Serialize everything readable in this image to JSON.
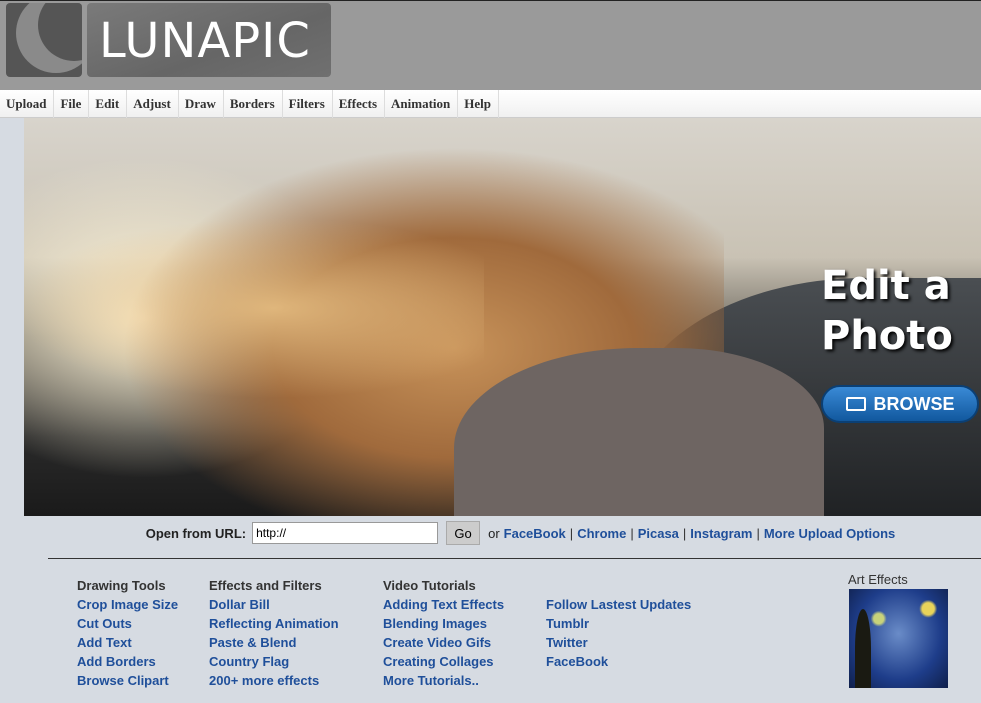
{
  "logo": {
    "text": "LUNAPIC"
  },
  "menu": [
    "Upload",
    "File",
    "Edit",
    "Adjust",
    "Draw",
    "Borders",
    "Filters",
    "Effects",
    "Animation",
    "Help"
  ],
  "hero": {
    "title_line1": "Edit a",
    "title_line2": "Photo",
    "browse_label": "BROWSE"
  },
  "url_bar": {
    "label": "Open from URL:",
    "value": "http://",
    "go_label": "Go",
    "or": "or",
    "links": [
      "FaceBook",
      "Chrome",
      "Picasa",
      "Instagram",
      "More Upload Options"
    ]
  },
  "columns": [
    {
      "heading": "Drawing Tools",
      "links": [
        "Crop Image Size",
        "Cut Outs",
        "Add Text",
        "Add Borders",
        "Browse Clipart"
      ]
    },
    {
      "heading": "Effects and Filters",
      "links": [
        "Dollar Bill",
        "Reflecting Animation",
        "Paste & Blend",
        "Country Flag",
        "200+ more effects"
      ]
    },
    {
      "heading": "Video Tutorials",
      "links": [
        "Adding Text Effects",
        "Blending Images",
        "Create Video Gifs",
        "Creating Collages",
        "More Tutorials.."
      ]
    },
    {
      "heading": "",
      "links": [
        "Follow Lastest Updates",
        "Tumblr",
        "Twitter",
        "FaceBook"
      ]
    }
  ],
  "art": {
    "label": "Art Effects"
  }
}
